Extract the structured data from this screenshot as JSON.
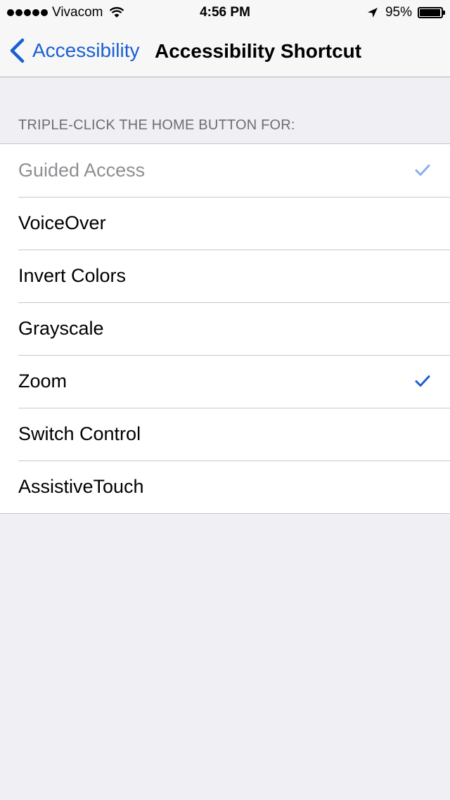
{
  "status_bar": {
    "carrier": "Vivacom",
    "time": "4:56 PM",
    "battery_percent_label": "95%",
    "battery_level": 0.95
  },
  "nav": {
    "back_label": "Accessibility",
    "title": "Accessibility Shortcut"
  },
  "section": {
    "header": "TRIPLE-CLICK THE HOME BUTTON FOR:"
  },
  "options": [
    {
      "label": "Guided Access",
      "checked": true,
      "disabled": true
    },
    {
      "label": "VoiceOver",
      "checked": false,
      "disabled": false
    },
    {
      "label": "Invert Colors",
      "checked": false,
      "disabled": false
    },
    {
      "label": "Grayscale",
      "checked": false,
      "disabled": false
    },
    {
      "label": "Zoom",
      "checked": true,
      "disabled": false
    },
    {
      "label": "Switch Control",
      "checked": false,
      "disabled": false
    },
    {
      "label": "AssistiveTouch",
      "checked": false,
      "disabled": false
    }
  ],
  "colors": {
    "accent": "#1a5fd3",
    "disabled_text": "#8e8e93",
    "background": "#efeff4"
  },
  "icons": {
    "back": "chevron-left-icon",
    "check": "checkmark-icon",
    "wifi": "wifi-icon",
    "location": "location-arrow-icon",
    "battery": "battery-icon"
  }
}
